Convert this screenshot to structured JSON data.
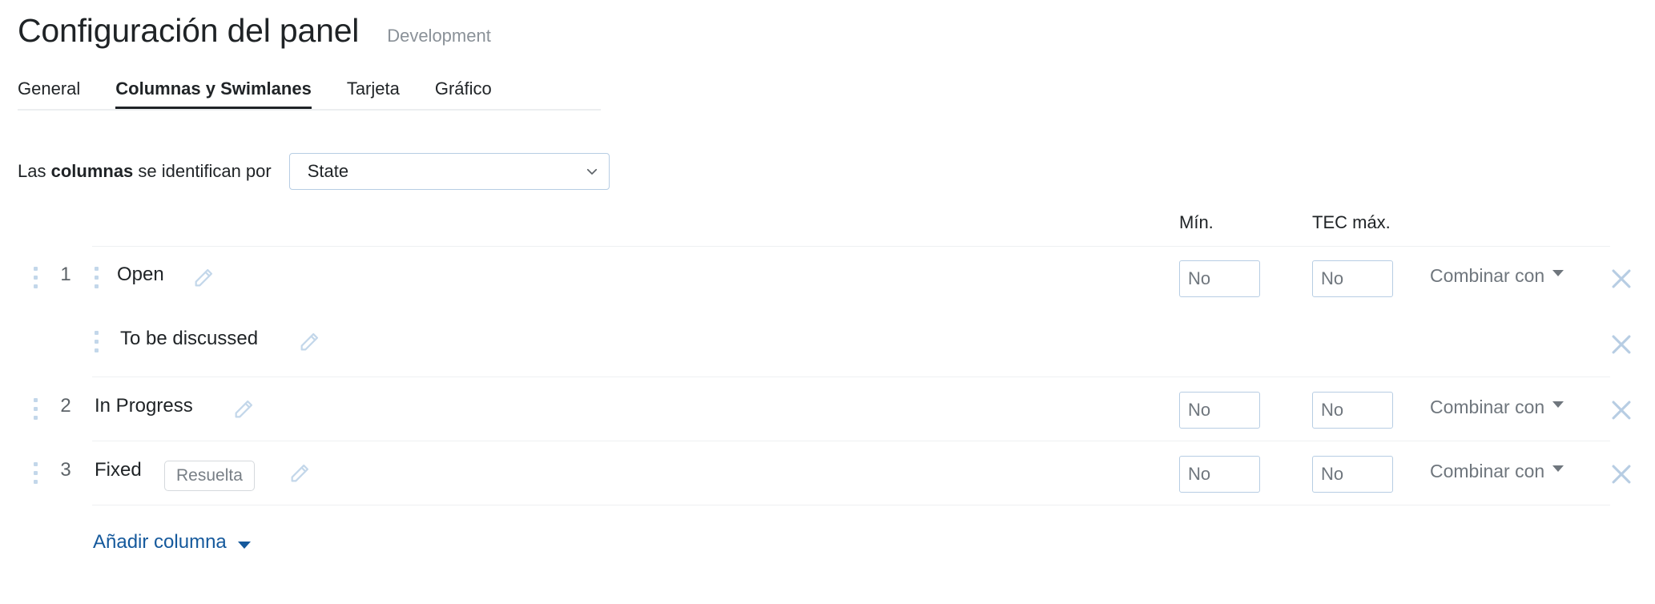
{
  "header": {
    "title": "Configuración del panel",
    "subtitle": "Development"
  },
  "tabs": [
    {
      "label": "General",
      "active": false
    },
    {
      "label": "Columnas y Swimlanes",
      "active": true
    },
    {
      "label": "Tarjeta",
      "active": false
    },
    {
      "label": "Gráfico",
      "active": false
    }
  ],
  "identify": {
    "label_before": "Las ",
    "label_bold": "columnas",
    "label_after": " se identifican por",
    "select_value": "State",
    "chevron_icon": "chevron-down-icon"
  },
  "table": {
    "headers": {
      "min": "Mín.",
      "tec_max": "TEC máx."
    },
    "merge_label": "Combinar con",
    "input_placeholder": "No",
    "rows": [
      {
        "number": "1",
        "name": "Open",
        "badge": null,
        "sub": false,
        "has_inputs": true,
        "min_value": "",
        "tec_value": "",
        "drag_icon": "drag-handle-icon",
        "edit_icon": "pencil-icon",
        "close_icon": "close-icon"
      },
      {
        "number": "",
        "name": "To be discussed",
        "badge": null,
        "sub": true,
        "has_inputs": false,
        "min_value": "",
        "tec_value": "",
        "drag_icon": "drag-handle-icon",
        "edit_icon": "pencil-icon",
        "close_icon": "close-icon"
      },
      {
        "number": "2",
        "name": "In Progress",
        "badge": null,
        "sub": false,
        "has_inputs": true,
        "min_value": "",
        "tec_value": "",
        "drag_icon": "drag-handle-icon",
        "edit_icon": "pencil-icon",
        "close_icon": "close-icon"
      },
      {
        "number": "3",
        "name": "Fixed",
        "badge": "Resuelta",
        "sub": false,
        "has_inputs": true,
        "min_value": "",
        "tec_value": "",
        "drag_icon": "drag-handle-icon",
        "edit_icon": "pencil-icon",
        "close_icon": "close-icon"
      }
    ]
  },
  "add_column": {
    "label": "Añadir columna",
    "caret_icon": "caret-down-icon"
  },
  "colors": {
    "accent_blue": "#15599c",
    "icon_blue": "#b7cde3",
    "border_blue": "#b7cde3",
    "text_primary": "#1f2326",
    "text_muted": "#8a9198",
    "rule": "#eef0f2",
    "tab_underline": "#1f2326"
  }
}
